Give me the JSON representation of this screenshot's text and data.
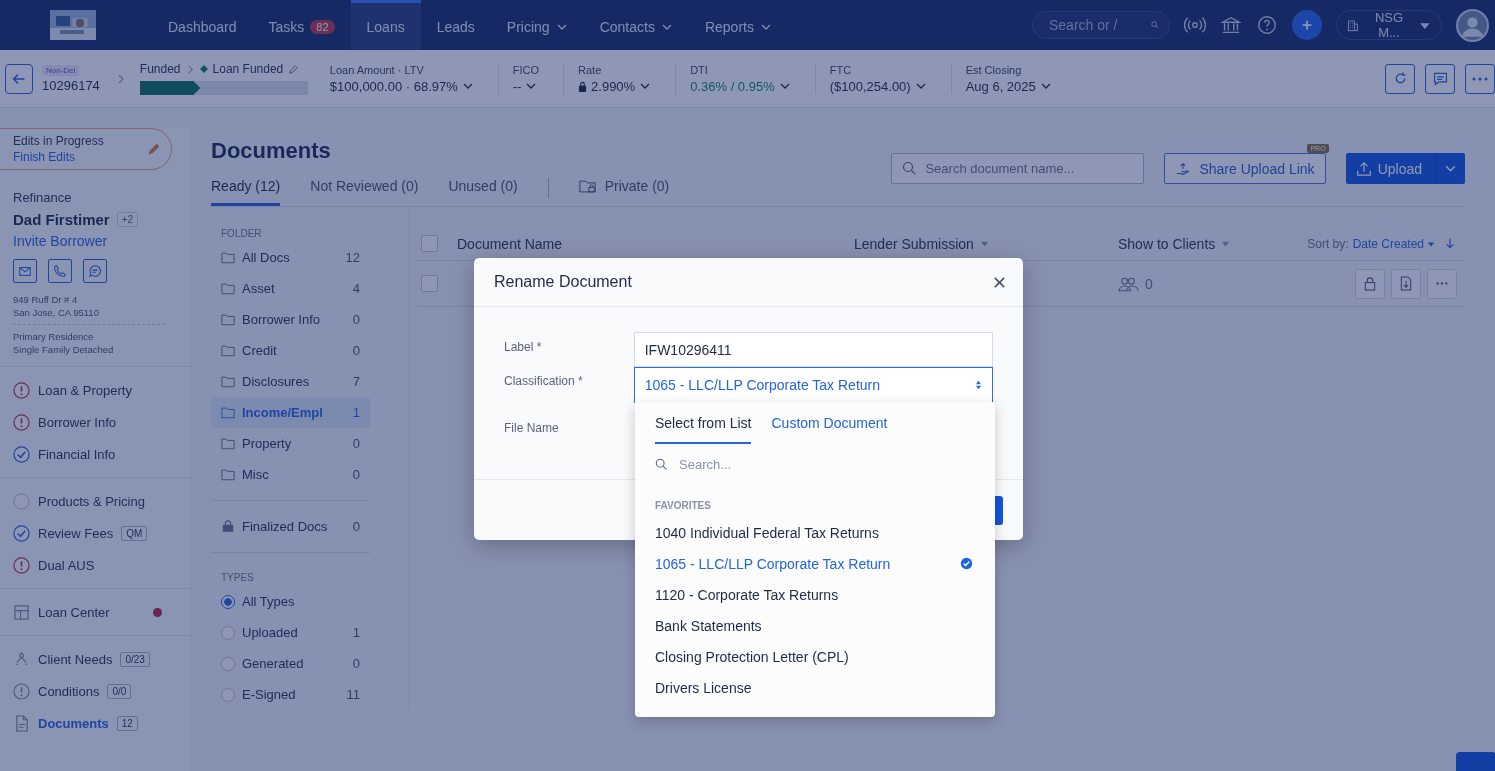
{
  "top_nav": {
    "items": [
      {
        "label": "Dashboard",
        "dropdown": false,
        "selected": false
      },
      {
        "label": "Tasks",
        "badge": "82",
        "dropdown": false,
        "selected": false
      },
      {
        "label": "Loans",
        "dropdown": false,
        "selected": true
      },
      {
        "label": "Leads",
        "dropdown": false,
        "selected": false
      },
      {
        "label": "Pricing",
        "dropdown": true,
        "selected": false
      },
      {
        "label": "Contacts",
        "dropdown": true,
        "selected": false
      },
      {
        "label": "Reports",
        "dropdown": true,
        "selected": false
      }
    ],
    "search": {
      "placeholder": "Search or /"
    },
    "organization": "NSG M..."
  },
  "loan_bar": {
    "channel": "Non-Del",
    "loan_number": "10296174",
    "stage": "Funded",
    "status": "Loan Funded",
    "progress": {
      "level": 0.36
    },
    "metrics": [
      {
        "label": "Loan Amount · LTV",
        "value": "$100,000.00 · 68.97%",
        "locked": false,
        "positive": false
      },
      {
        "label": "FICO",
        "value": "--",
        "locked": false,
        "positive": false
      },
      {
        "label": "Rate",
        "value": "2.990%",
        "locked": true,
        "positive": false
      },
      {
        "label": "DTI",
        "value": "0.36% / 0.95%",
        "locked": false,
        "positive": true
      },
      {
        "label": "FTC",
        "value": "($100,254.00)",
        "locked": false,
        "positive": false
      },
      {
        "label": "Est Closing",
        "value": "Aug 6, 2025",
        "locked": false,
        "positive": false
      }
    ]
  },
  "sidebar": {
    "edits": {
      "title": "Edits in Progress",
      "link": "Finish Edits"
    },
    "loan_purpose": "Refinance",
    "borrower": {
      "name": "Dad Firstimer",
      "extra": "+2"
    },
    "invite": "Invite Borrower",
    "address": [
      "949 Ruff Dr # 4",
      "San Jose, CA 95110"
    ],
    "property": [
      "Primary Residence",
      "Single Family Detached"
    ],
    "sections": [
      [
        {
          "kind": "step",
          "label": "Loan & Property",
          "warning": true,
          "selected": false
        },
        {
          "kind": "step",
          "label": "Borrower Info",
          "warning": true,
          "selected": false
        },
        {
          "kind": "step",
          "label": "Financial Info",
          "complete": true,
          "selected": false
        }
      ],
      [
        {
          "kind": "step",
          "label": "Products & Pricing",
          "complete": false,
          "warning": false,
          "selected": false
        },
        {
          "kind": "step",
          "label": "Review Fees",
          "complete": true,
          "badge": "QM",
          "selected": false
        },
        {
          "kind": "step",
          "label": "Dual AUS",
          "warning": true,
          "selected": false
        }
      ],
      [
        {
          "kind": "link",
          "label": "Loan Center",
          "alert": true,
          "selected": false
        }
      ],
      [
        {
          "kind": "link",
          "label": "Client Needs",
          "badge": "0/23",
          "alert": false,
          "selected": false
        },
        {
          "kind": "link",
          "label": "Conditions",
          "badge": "0/0",
          "alert": false,
          "selected": false
        },
        {
          "kind": "link",
          "label": "Documents",
          "badge": "12",
          "alert": false,
          "selected": true
        }
      ]
    ]
  },
  "documents": {
    "title": "Documents",
    "tabs": [
      {
        "label": "Ready (12)",
        "selected": true
      },
      {
        "label": "Not Reviewed (0)",
        "selected": false
      },
      {
        "label": "Unused (0)",
        "selected": false
      },
      {
        "label": "Private (0)",
        "kind": "private",
        "selected": false
      }
    ],
    "search": {
      "placeholder": "Search document name..."
    },
    "share_button": "Share Upload Link",
    "pro_badge": "PRO",
    "upload_button": "Upload",
    "folder_heading": "FOLDER",
    "folders": [
      {
        "label": "All Docs",
        "count": "12",
        "selected": false
      },
      {
        "label": "Asset",
        "count": "4",
        "selected": false
      },
      {
        "label": "Borrower Info",
        "count": "0",
        "selected": false
      },
      {
        "label": "Credit",
        "count": "0",
        "selected": false
      },
      {
        "label": "Disclosures",
        "count": "7",
        "selected": false
      },
      {
        "label": "Income/Empl",
        "count": "1",
        "selected": true
      },
      {
        "label": "Property",
        "count": "0",
        "selected": false
      },
      {
        "label": "Misc",
        "count": "0",
        "selected": false
      }
    ],
    "finalized": {
      "label": "Finalized Docs",
      "count": "0"
    },
    "types_heading": "TYPES",
    "types": [
      {
        "label": "All Types",
        "selected": true
      },
      {
        "label": "Uploaded",
        "count": "1",
        "selected": false
      },
      {
        "label": "Generated",
        "count": "0",
        "selected": false
      },
      {
        "label": "E-Signed",
        "count": "11",
        "selected": false
      }
    ],
    "table": {
      "select_all_checked": false,
      "columns": [
        "Document Name",
        "Lender Submission",
        "Show to Clients"
      ],
      "sort_label": "Sort by:",
      "sort_value": "Date Created",
      "rows": [
        {
          "checked": false,
          "clients": "0"
        }
      ]
    }
  },
  "modal": {
    "title": "Rename Document",
    "fields": [
      {
        "label": "Label *",
        "value": "IFW10296411"
      },
      {
        "label": "Classification *",
        "value": "1065 - LLC/LLP Corporate Tax Return"
      },
      {
        "label": "File Name"
      }
    ],
    "dropdown": {
      "tabs": [
        {
          "label": "Select from List",
          "selected": true
        },
        {
          "label": "Custom Document",
          "selected": false
        }
      ],
      "search": {
        "placeholder": "Search..."
      },
      "group": "FAVORITES",
      "options": [
        {
          "label": "1040 Individual Federal Tax Returns",
          "selected": false
        },
        {
          "label": "1065 - LLC/LLP Corporate Tax Return",
          "selected": true
        },
        {
          "label": "1120 - Corporate Tax Returns",
          "selected": false
        },
        {
          "label": "Bank Statements",
          "selected": false
        },
        {
          "label": "Closing Protection Letter (CPL)",
          "selected": false
        },
        {
          "label": "Drivers License",
          "selected": false
        }
      ]
    }
  }
}
